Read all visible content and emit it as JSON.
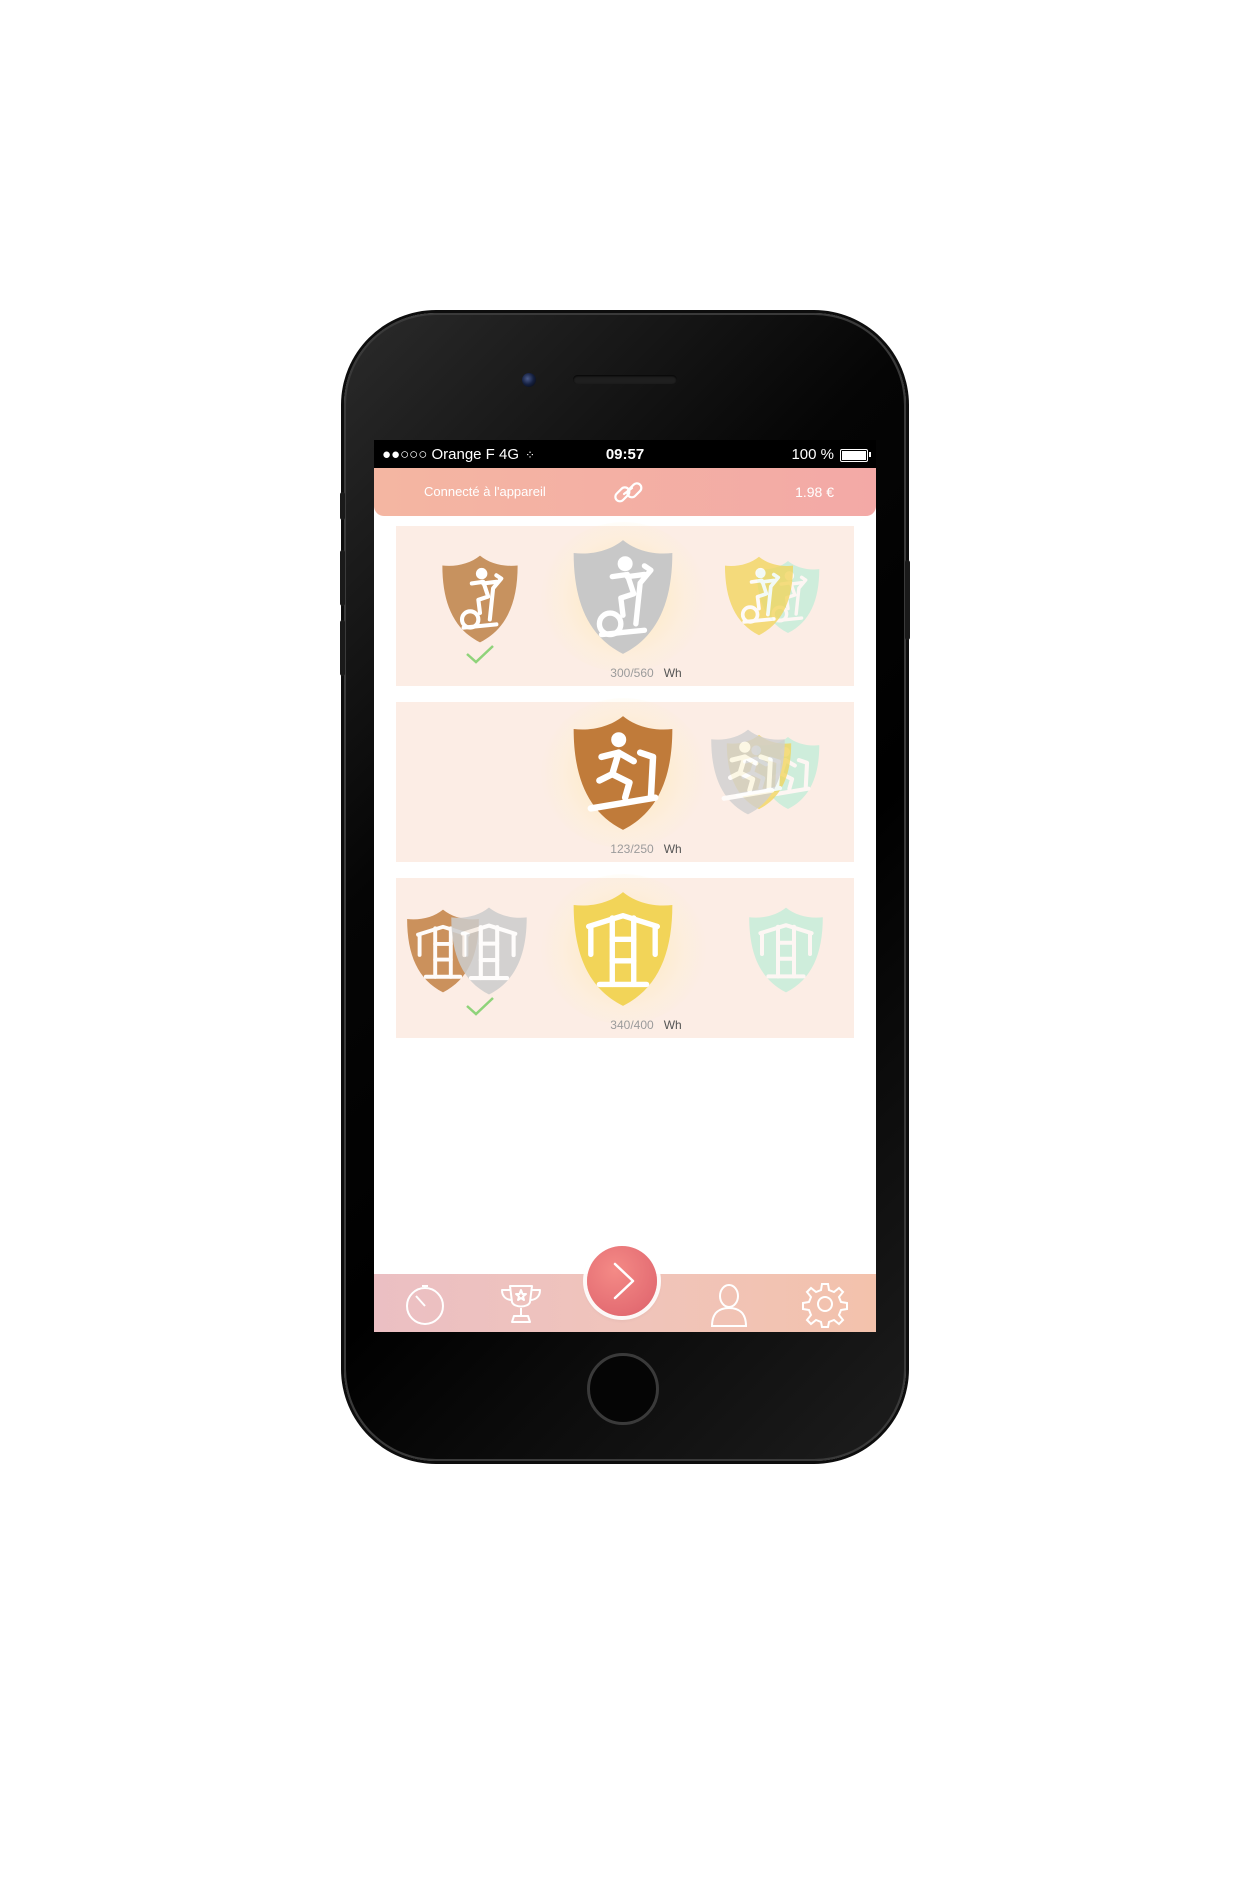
{
  "status_bar": {
    "carrier": "●●○○○ Orange F   4G",
    "time": "09:57",
    "battery": "100 %"
  },
  "top_bar": {
    "connection_label": "Connecté à l'appareil",
    "balance": "1.98 €"
  },
  "rows": [
    {
      "equipment": "exercise-bike",
      "progress": "300/560",
      "unit": "Wh"
    },
    {
      "equipment": "treadmill",
      "progress": "123/250",
      "unit": "Wh"
    },
    {
      "equipment": "weight-machine",
      "progress": "340/400",
      "unit": "Wh"
    }
  ],
  "tab_bar": {
    "tabs": [
      "stopwatch-icon",
      "trophy-icon",
      "next-icon",
      "user-icon",
      "gear-icon"
    ]
  },
  "colors": {
    "bronze": "#c07b3a",
    "silver": "#c8c8c8",
    "gold": "#f2d458",
    "mint": "#a9eed3",
    "accent": "#e46d73"
  }
}
